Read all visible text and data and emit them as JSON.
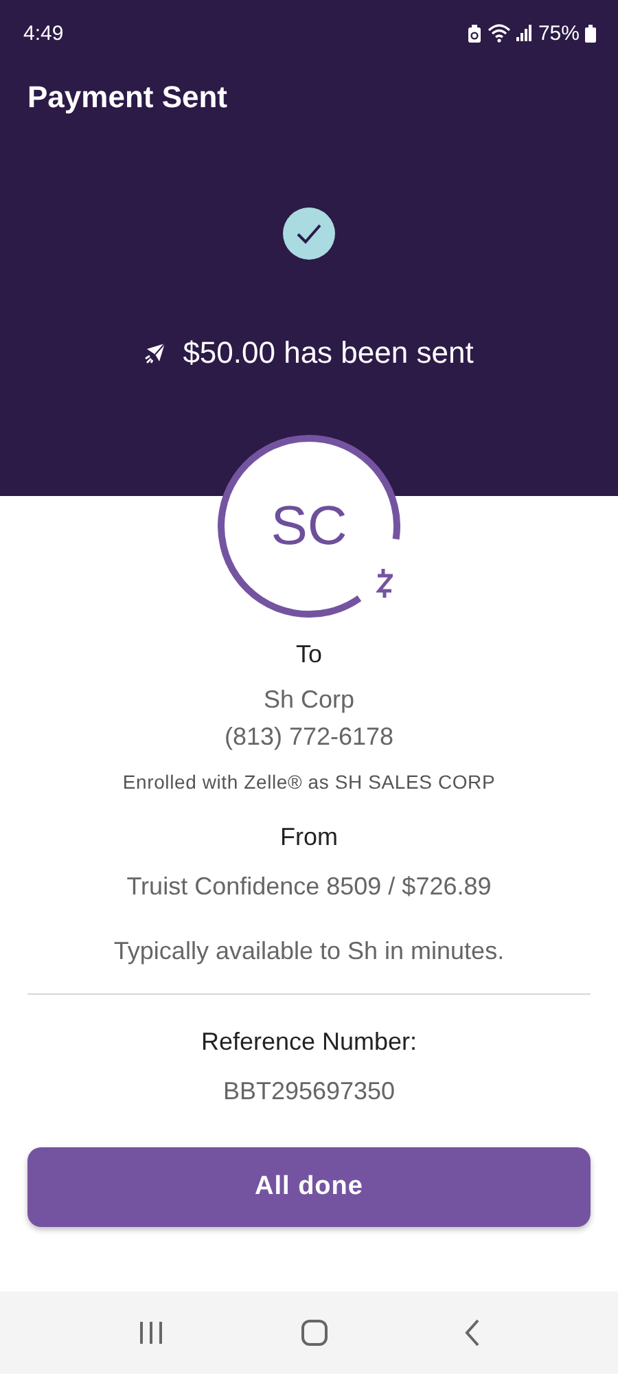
{
  "status_bar": {
    "time": "4:49",
    "battery": "75%"
  },
  "header": {
    "title": "Payment Sent",
    "message": "$50.00 has been sent"
  },
  "recipient": {
    "initials": "SC",
    "label": "To",
    "name": "Sh Corp",
    "phone": "(813) 772-6178",
    "enrolled": "Enrolled with Zelle® as SH SALES CORP"
  },
  "sender": {
    "label": "From",
    "account": "Truist Confidence 8509 / $726.89"
  },
  "availability": "Typically available to Sh in minutes.",
  "reference": {
    "label": "Reference Number:",
    "value": "BBT295697350"
  },
  "button": "All done"
}
